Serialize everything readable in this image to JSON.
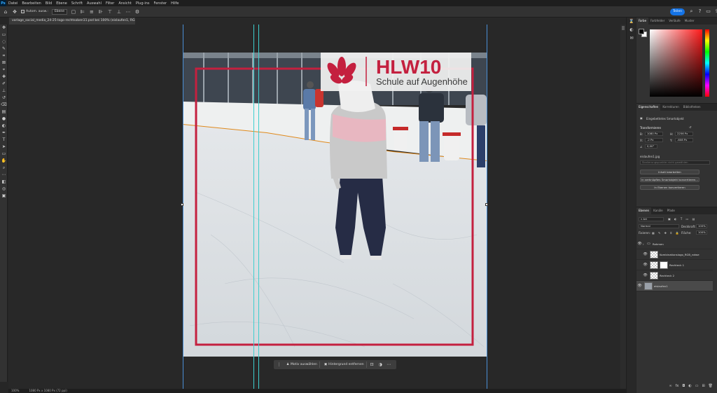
{
  "app": {
    "logo": "Ps"
  },
  "menu": [
    "Datei",
    "Bearbeiten",
    "Bild",
    "Ebene",
    "Schrift",
    "Auswahl",
    "Filter",
    "Ansicht",
    "Plug-ins",
    "Fenster",
    "Hilfe"
  ],
  "options": {
    "autoselect_label": "Autom. ausw.:",
    "autoselect_value": "Ebene",
    "share_label": "Teilen"
  },
  "document": {
    "tab_title": "vorlage_social_media_24-25-logo-rechtsoben11.psd bei 100% (eislaufen1, RGB/8) *"
  },
  "logo": {
    "title": "HLW10",
    "subtitle": "Schule auf Augenhöhe",
    "color": "#c4203f"
  },
  "taskbar": {
    "select_subject": "Motiv auswählen",
    "remove_background": "Hintergrund entfernen"
  },
  "status": {
    "zoom": "100%",
    "size": "1080 Px x 1080 Px (72 ppi)"
  },
  "color_panel": {
    "tabs": [
      "Farbe",
      "Farbfelder",
      "Verläufe",
      "Muster"
    ]
  },
  "properties": {
    "tabs": [
      "Eigenschaften",
      "Korrekturen",
      "Bibliotheken"
    ],
    "type_label": "Eingebettetes Smartobjekt",
    "transform_label": "Transformieren",
    "w_label": "B:",
    "w_value": "1080 Px",
    "h_label": "H:",
    "h_value": "2256 Px",
    "x_label": "X:",
    "x_value": "-2 Px",
    "y_label": "Y:",
    "y_value": "-608 Px",
    "angle_value": "0,00°",
    "source_file": "eislaufen1.jpg",
    "source_note": "Skalierungspunkte nicht gewählen",
    "btn_edit": "Inhalt bearbeiten",
    "btn_convert_linked": "In verknüpftes Smartobjekt konvertieren...",
    "btn_convert_layers": "In Ebenen konvertieren"
  },
  "layers": {
    "tabs": [
      "Ebenen",
      "Kanäle",
      "Pfade"
    ],
    "kind_label": "Art",
    "blend_mode": "Normal",
    "opacity_label": "Deckkraft:",
    "opacity_value": "100%",
    "lock_label": "Fixieren:",
    "fill_label": "Fläche:",
    "fill_value": "100%",
    "items": [
      {
        "name": "Rahmen",
        "type": "group"
      },
      {
        "name": "Kombinationslogo_RGB_rotwe",
        "type": "smart"
      },
      {
        "name": "Rechteck 1",
        "type": "shape"
      },
      {
        "name": "Rechteck 2",
        "type": "shape"
      },
      {
        "name": "eislaufen1",
        "type": "smart",
        "selected": true
      }
    ]
  },
  "colors": {
    "accent": "#1473e6",
    "frame": "#c4203f",
    "bg": "#262626",
    "panel": "#323232"
  }
}
